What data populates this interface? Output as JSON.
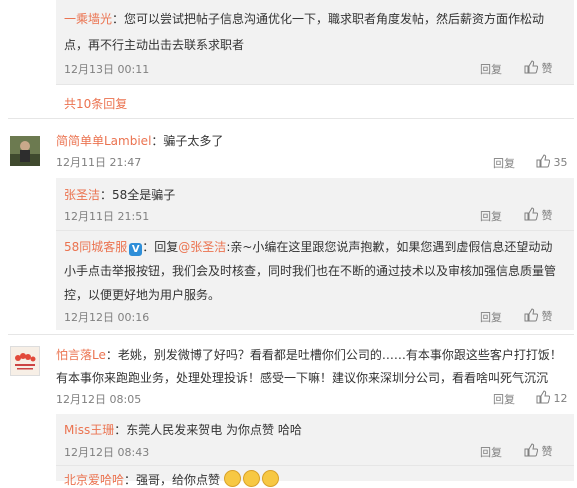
{
  "comments": {
    "c1": {
      "author": "一乘墙光",
      "text1": "：您可以尝试把帖子信息沟通优化一下，職求职者角度发帖，然后薪资方面作松动",
      "text2": "点，再不行主动出击去联系求职者",
      "time": "12月13日 00:11",
      "reply": "回复",
      "like": "赞"
    },
    "more_replies": "共10条回复",
    "c2": {
      "author": "简简单单Lambiel",
      "text": "：骗子太多了",
      "time": "12月11日 21:47",
      "reply": "回复",
      "likes": "35"
    },
    "c3": {
      "author": "张圣洁",
      "text": "：58全是骗子",
      "time": "12月11日 21:51",
      "reply": "回复",
      "like": "赞"
    },
    "c4": {
      "author": "58同城客服",
      "verified": "V",
      "text1_prefix": "：回复",
      "mention": "@张圣洁",
      "text1_rest": ":亲~小编在这里跟您说声抱歉，如果您遇到虚假信息还望动动",
      "text2": "小手点击举报按钮，我们会及时核查，同时我们也在不断的通过技术以及审核加强信息质量管",
      "text3": "控，以便更好地为用户服务。",
      "time": "12月12日 00:16",
      "reply": "回复",
      "like": "赞"
    },
    "c5": {
      "author": "怕言落Le",
      "text1": "：老姚，别发微博了好吗？看看都是吐槽你们公司的……有本事你跟这些客户打打饭！",
      "text2": "有本事你来跑跑业务，处理处理投诉！感受一下嘛！建议你来深圳分公司，看看啥叫死气沉沉",
      "time": "12月12日 08:05",
      "reply": "回复",
      "likes": "12"
    },
    "c6": {
      "author": "Miss王珊",
      "text": "：东莞人民发来贺电 为你点赞 哈哈",
      "time": "12月12日 08:43",
      "reply": "回复",
      "like": "赞"
    },
    "c7": {
      "author": "北京爱哈哈",
      "text": "：强哥，给你点赞"
    }
  },
  "colors": {
    "name": "#eb7350",
    "time": "#808080",
    "reply_bg": "#f2f2f2",
    "verified": "#2e8ed8"
  },
  "icons": [
    "thumbs-up-icon",
    "verified-badge-icon",
    "smile-emoji-icon"
  ]
}
